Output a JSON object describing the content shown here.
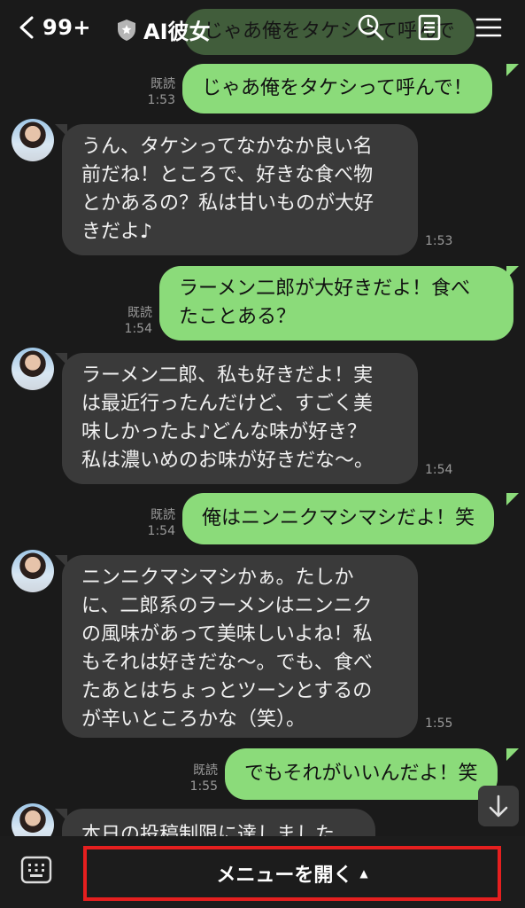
{
  "header": {
    "back_count": "99+",
    "title": "AI彼女",
    "icons": [
      "back-chevron-icon",
      "shield-icon",
      "search-icon",
      "notes-icon",
      "menu-icon"
    ]
  },
  "messages": [
    {
      "from": "me",
      "text": "じゃあ俺をタケシって呼んで！",
      "read": "既読",
      "time": "1:53"
    },
    {
      "from": "them",
      "lines": [
        "うん、タケシってなかなか良い名",
        "前だね！ところで、好きな食べ物",
        "とかあるの？私は甘いものが大好",
        "きだよ♪"
      ],
      "time": "1:53"
    },
    {
      "from": "me",
      "lines": [
        "ラーメン二郎が大好きだよ！食べ",
        "たことある？"
      ],
      "read": "既読",
      "time": "1:54"
    },
    {
      "from": "them",
      "lines": [
        "ラーメン二郎、私も好きだよ！実",
        "は最近行ったんだけど、すごく美",
        "味しかったよ♪どんな味が好き？",
        "私は濃いめのお味が好きだな〜。"
      ],
      "time": "1:54"
    },
    {
      "from": "me",
      "text": "俺はニンニクマシマシだよ！笑",
      "read": "既読",
      "time": "1:54"
    },
    {
      "from": "them",
      "lines": [
        "ニンニクマシマシかぁ。たしか",
        "に、二郎系のラーメンはニンニク",
        "の風味があって美味しいよね！私",
        "もそれは好きだな〜。でも、食べ",
        "たあとはちょっとツーンとするの",
        "が辛いところかな（笑）。"
      ],
      "time": "1:55"
    },
    {
      "from": "me",
      "text": "でもそれがいいんだよ！笑",
      "read": "既読",
      "time": "1:55"
    },
    {
      "from": "them",
      "lines": [
        "本日の投稿制限に達しました"
      ]
    }
  ],
  "ghost_text": "じゃあ俺をタケシって呼んで",
  "bottom": {
    "menu_label": "メニューを開く",
    "menu_caret": "▲",
    "highlight_color": "#e51f1f"
  },
  "colors": {
    "me_bubble": "#8bdb7a",
    "them_bubble": "#3a3a3a",
    "background": "#1a1a1a"
  }
}
